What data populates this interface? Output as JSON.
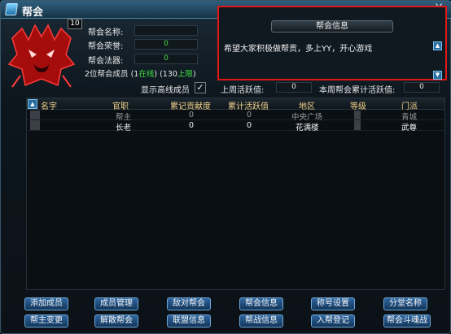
{
  "window": {
    "title": "帮会",
    "close_symbol": "X"
  },
  "guild": {
    "level": "10",
    "name_label": "帮会名称:",
    "name_value": "",
    "honor_label": "帮会荣誉:",
    "honor_value": "0",
    "artifact_label": "帮会法器:",
    "artifact_value": "0",
    "members_prefix": "2位帮会成员 (1",
    "members_online": "在线",
    "members_mid": ") (130",
    "members_limit": "上限",
    "members_suffix": ")"
  },
  "filters": {
    "show_offline_label": "显示高线成员",
    "show_offline_checked": "✓",
    "last_week_label": "上周活跃值:",
    "last_week_value": "0",
    "cumulative_label": "本周帮会累计活跃值:",
    "cumulative_value": "0"
  },
  "notice": {
    "tab_label": "帮会信息",
    "text": "希望大家积极做帮贡，多上YY，开心游戏",
    "scroll_up": "▲",
    "scroll_down": "▼"
  },
  "table": {
    "headers": [
      "名字",
      "官职",
      "累记贡献度",
      "累计活跃值",
      "地区",
      "等级",
      "门派"
    ],
    "rows": [
      {
        "name": "",
        "rank": "帮主",
        "contrib": "0",
        "active": "0",
        "region": "中央广场",
        "level": "",
        "sect": "青城"
      },
      {
        "name": "",
        "rank": "长老",
        "contrib": "0",
        "active": "0",
        "region": "花满楼",
        "level": "",
        "sect": "武尊"
      }
    ]
  },
  "buttons": {
    "add_member": "添加成员",
    "member_manage": "成员管理",
    "enemy_guild": "敌对帮会",
    "guild_info": "帮会信息",
    "title_settings": "称号设置",
    "branch_name": "分堂名称",
    "change_leader": "帮主变更",
    "disband": "解散帮会",
    "alliance_info": "联盟信息",
    "guild_war_info": "帮战信息",
    "join_register": "入帮登记",
    "guild_battle": "帮会斗魂战"
  },
  "colors": {
    "accent": "#2e66a0",
    "notice_border": "#e01818",
    "online": "#43e043"
  }
}
